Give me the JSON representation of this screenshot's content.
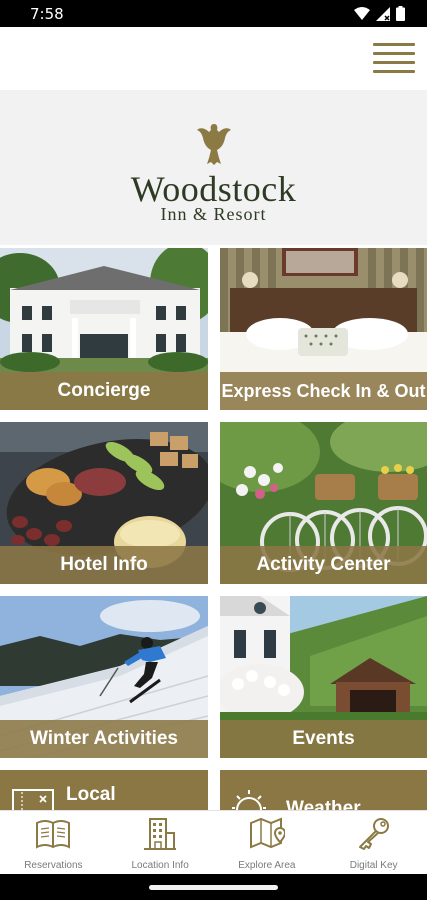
{
  "status_bar": {
    "time": "7:58"
  },
  "brand": {
    "name": "Woodstock",
    "tagline": "Inn & Resort"
  },
  "tiles": [
    {
      "label": "Concierge"
    },
    {
      "label": "Express Check In & Out"
    },
    {
      "label": "Hotel Info"
    },
    {
      "label": "Activity Center"
    },
    {
      "label": "Winter Activities"
    },
    {
      "label": "Events"
    },
    {
      "label": "Local"
    },
    {
      "label": "Weather"
    }
  ],
  "bottom_nav": [
    {
      "label": "Reservations",
      "icon": "book-icon"
    },
    {
      "label": "Location Info",
      "icon": "building-icon"
    },
    {
      "label": "Explore Area",
      "icon": "map-icon"
    },
    {
      "label": "Digital Key",
      "icon": "key-icon"
    }
  ],
  "colors": {
    "accent": "#8c7a45",
    "tile_overlay": "#8c7646",
    "logo_text": "#2e3b24"
  }
}
